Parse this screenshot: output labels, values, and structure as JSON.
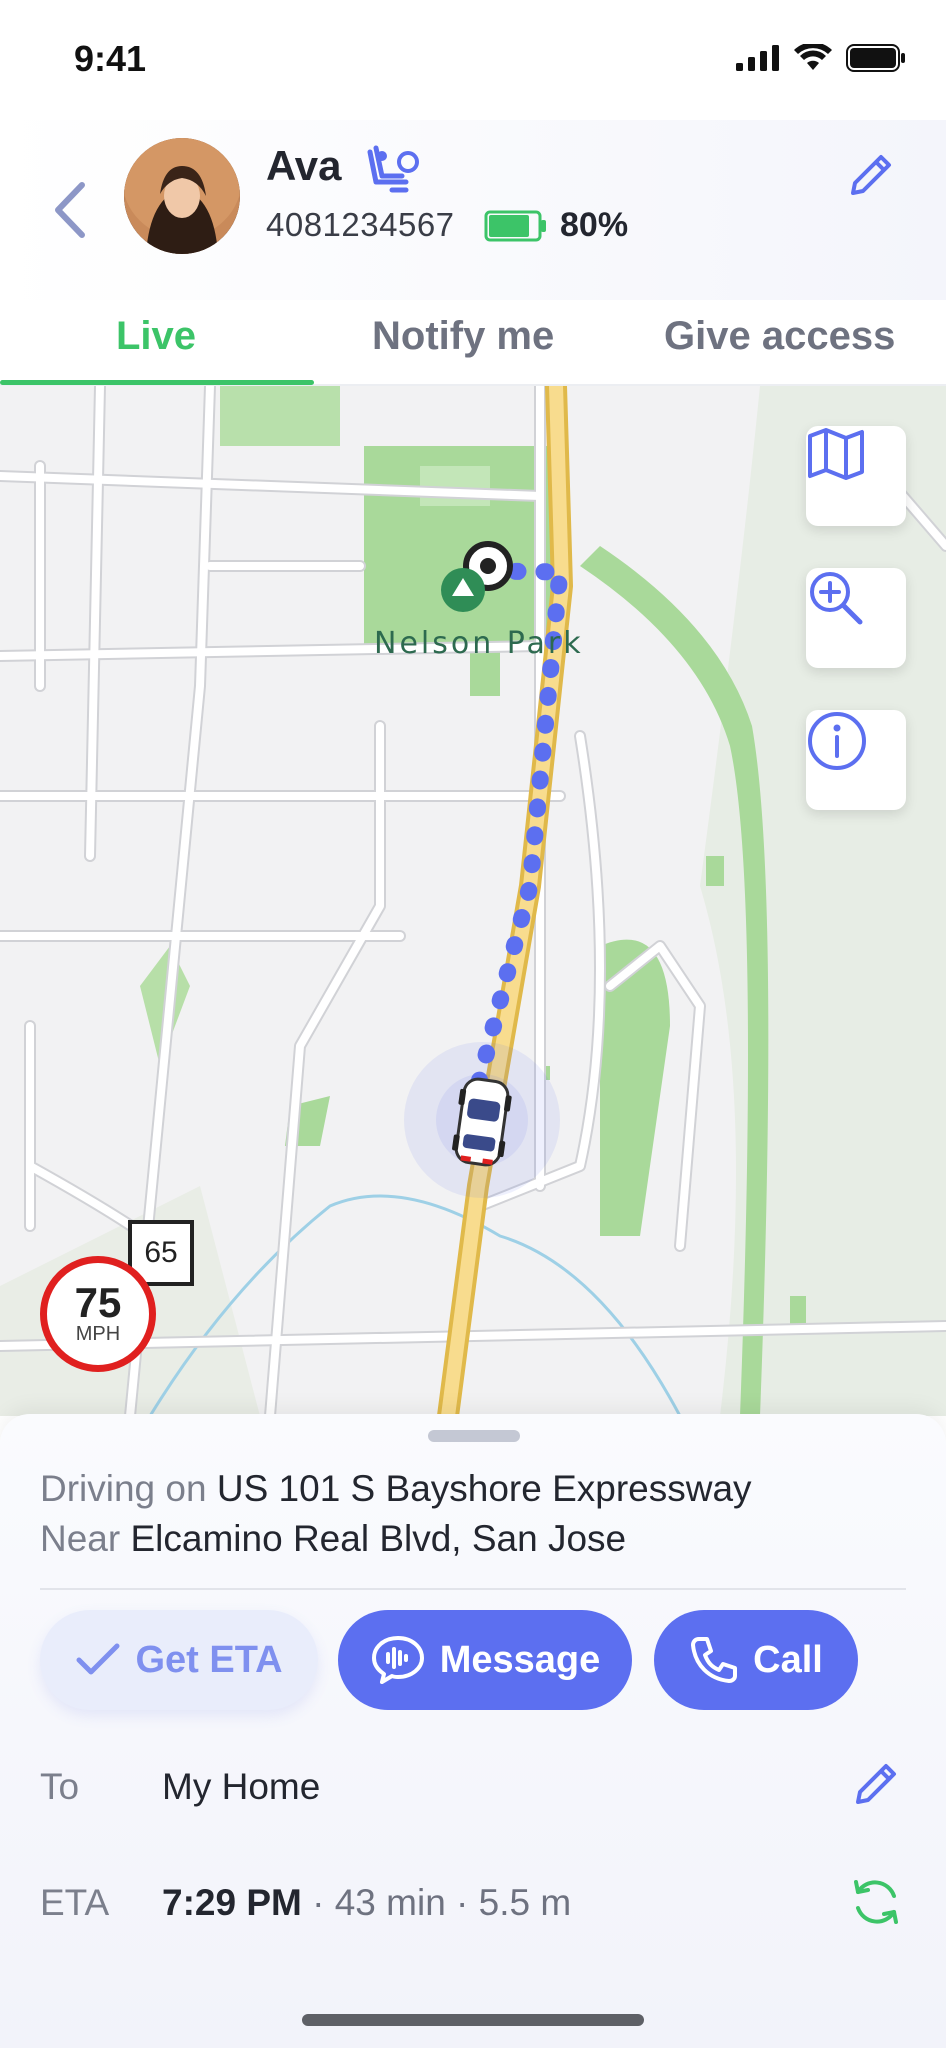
{
  "status_bar": {
    "time": "9:41"
  },
  "header": {
    "user_name": "Ava",
    "phone": "4081234567",
    "battery": "80%",
    "icons": {
      "back": "chevron-left-icon",
      "seat": "driver-seat-icon",
      "battery": "battery-icon",
      "edit": "pencil-icon"
    }
  },
  "tabs": [
    {
      "label": "Live",
      "active": true
    },
    {
      "label": "Notify me",
      "active": false
    },
    {
      "label": "Give access",
      "active": false
    }
  ],
  "map": {
    "park_label": "Nelson Park",
    "speed": "75",
    "speed_unit": "MPH",
    "speed_limit": "65",
    "controls": [
      "map-icon",
      "zoom-in-icon",
      "info-icon"
    ]
  },
  "sheet": {
    "line1_prefix": "Driving on",
    "line1_value": "US 101 S Bayshore Expressway",
    "line2_prefix": "Near",
    "line2_value": "Elcamino Real Blvd, San Jose",
    "buttons": {
      "eta": "Get ETA",
      "message": "Message",
      "call": "Call"
    },
    "to_label": "To",
    "to_value": "My Home",
    "eta_label": "ETA",
    "eta_time": "7:29 PM",
    "eta_details": " · 43 min · 5.5 m"
  },
  "colors": {
    "accent": "#5c6ff0",
    "green": "#3cc468",
    "speed_red": "#e0201f"
  }
}
